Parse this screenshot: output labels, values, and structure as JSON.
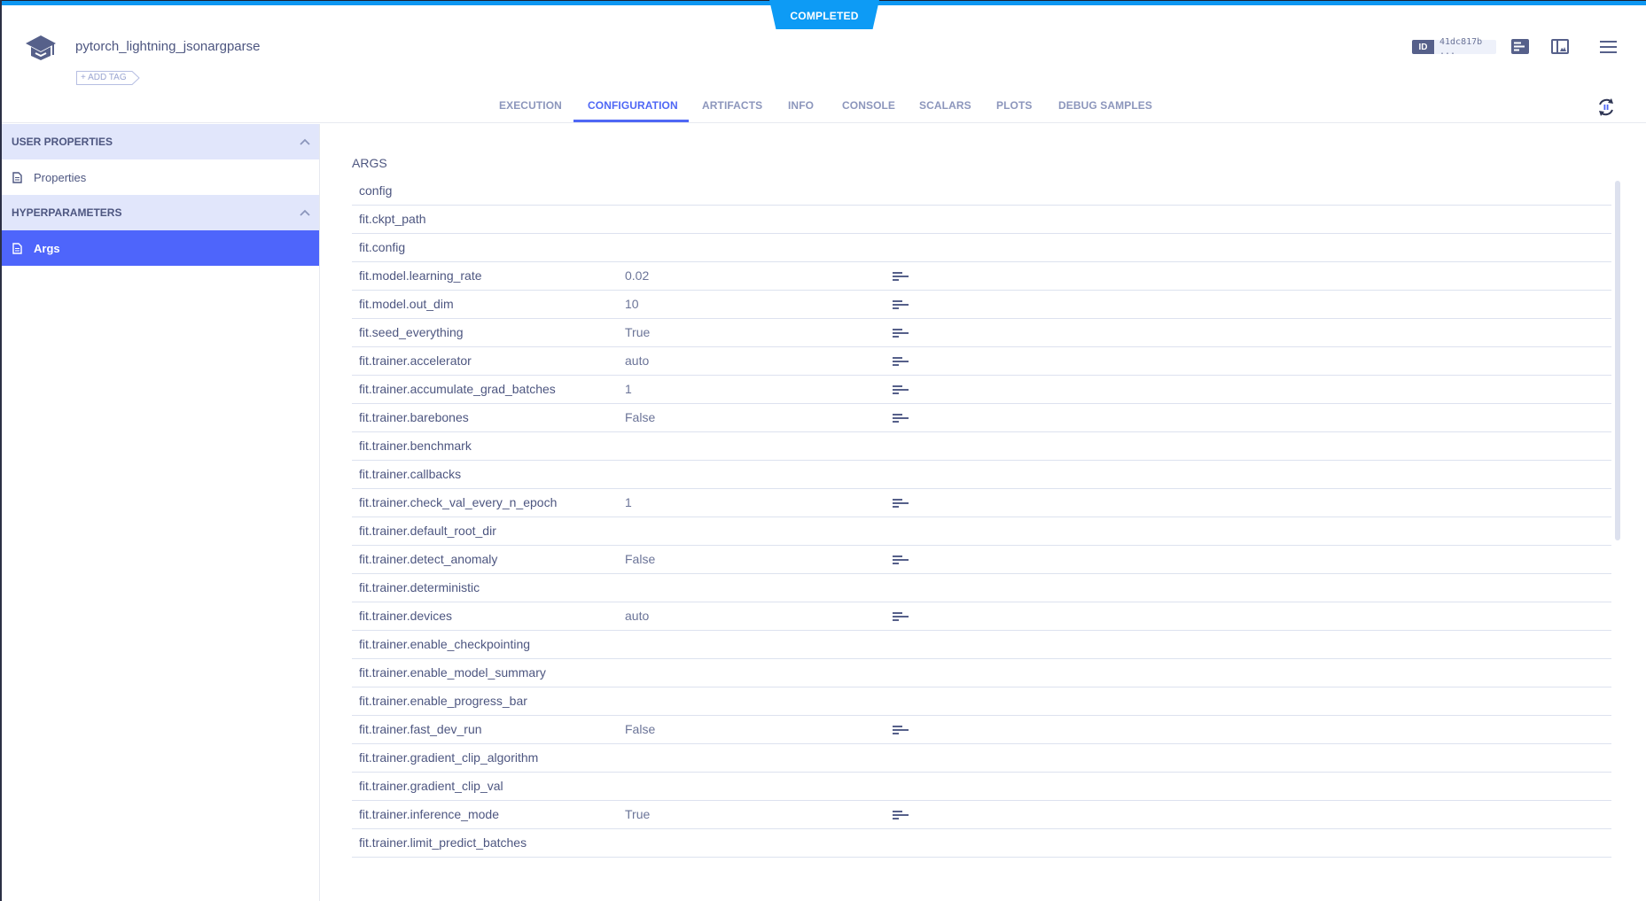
{
  "status": "COMPLETED",
  "task": {
    "title": "pytorch_lightning_jsonargparse",
    "add_tag_label": "+ ADD TAG",
    "id_tag": "ID",
    "id_value": "41dc817b ..."
  },
  "tabs": [
    {
      "label": "EXECUTION",
      "active": false
    },
    {
      "label": "CONFIGURATION",
      "active": true
    },
    {
      "label": "ARTIFACTS",
      "active": false
    },
    {
      "label": "INFO",
      "active": false
    },
    {
      "label": "CONSOLE",
      "active": false
    },
    {
      "label": "SCALARS",
      "active": false
    },
    {
      "label": "PLOTS",
      "active": false
    },
    {
      "label": "DEBUG SAMPLES",
      "active": false
    }
  ],
  "header_icons": [
    "details-icon",
    "layout-icon",
    "menu-icon",
    "auto-refresh-pause-icon"
  ],
  "sidebar": {
    "sections": [
      {
        "title": "USER PROPERTIES",
        "items": [
          {
            "label": "Properties",
            "active": false
          }
        ]
      },
      {
        "title": "HYPERPARAMETERS",
        "items": [
          {
            "label": "Args",
            "active": true
          }
        ]
      }
    ]
  },
  "section_title": "ARGS",
  "args": [
    {
      "name": "config",
      "value": "",
      "has_desc": false
    },
    {
      "name": "fit.ckpt_path",
      "value": "",
      "has_desc": false
    },
    {
      "name": "fit.config",
      "value": "",
      "has_desc": false
    },
    {
      "name": "fit.model.learning_rate",
      "value": "0.02",
      "has_desc": true
    },
    {
      "name": "fit.model.out_dim",
      "value": "10",
      "has_desc": true
    },
    {
      "name": "fit.seed_everything",
      "value": "True",
      "has_desc": true
    },
    {
      "name": "fit.trainer.accelerator",
      "value": "auto",
      "has_desc": true
    },
    {
      "name": "fit.trainer.accumulate_grad_batches",
      "value": "1",
      "has_desc": true
    },
    {
      "name": "fit.trainer.barebones",
      "value": "False",
      "has_desc": true
    },
    {
      "name": "fit.trainer.benchmark",
      "value": "",
      "has_desc": false
    },
    {
      "name": "fit.trainer.callbacks",
      "value": "",
      "has_desc": false
    },
    {
      "name": "fit.trainer.check_val_every_n_epoch",
      "value": "1",
      "has_desc": true
    },
    {
      "name": "fit.trainer.default_root_dir",
      "value": "",
      "has_desc": false
    },
    {
      "name": "fit.trainer.detect_anomaly",
      "value": "False",
      "has_desc": true
    },
    {
      "name": "fit.trainer.deterministic",
      "value": "",
      "has_desc": false
    },
    {
      "name": "fit.trainer.devices",
      "value": "auto",
      "has_desc": true
    },
    {
      "name": "fit.trainer.enable_checkpointing",
      "value": "",
      "has_desc": false
    },
    {
      "name": "fit.trainer.enable_model_summary",
      "value": "",
      "has_desc": false
    },
    {
      "name": "fit.trainer.enable_progress_bar",
      "value": "",
      "has_desc": false
    },
    {
      "name": "fit.trainer.fast_dev_run",
      "value": "False",
      "has_desc": true
    },
    {
      "name": "fit.trainer.gradient_clip_algorithm",
      "value": "",
      "has_desc": false
    },
    {
      "name": "fit.trainer.gradient_clip_val",
      "value": "",
      "has_desc": false
    },
    {
      "name": "fit.trainer.inference_mode",
      "value": "True",
      "has_desc": true
    },
    {
      "name": "fit.trainer.limit_predict_batches",
      "value": "",
      "has_desc": false
    }
  ],
  "colors": {
    "accent": "#4f67f5",
    "status": "#0d9bf5",
    "text": "#4d5680",
    "sidebar_header_bg": "#e1e6fb"
  }
}
